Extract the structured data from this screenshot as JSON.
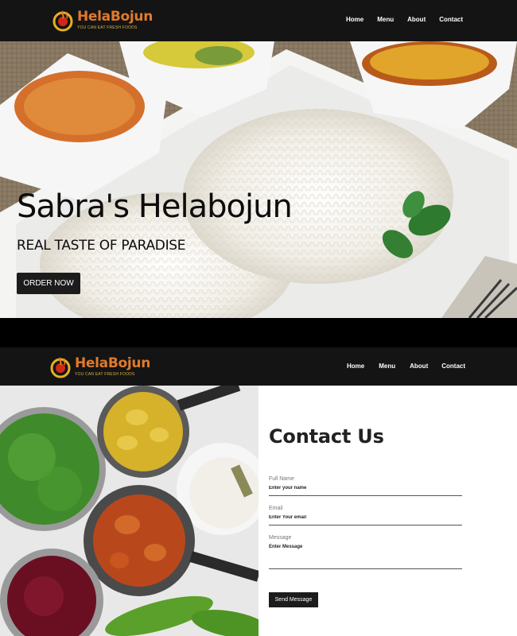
{
  "brand": {
    "name": "HelaBojun",
    "tagline": "YOU CAN EAT FRESH FOODS",
    "color": "#e07a2b"
  },
  "nav": {
    "items": [
      {
        "label": "Home"
      },
      {
        "label": "Menu"
      },
      {
        "label": "About"
      },
      {
        "label": "Contact"
      }
    ]
  },
  "hero": {
    "title": "Sabra's Helabojun",
    "subtitle": "REAL TASTE OF PARADISE",
    "cta_label": "ORDER NOW"
  },
  "contact": {
    "title": "Contact Us",
    "fields": {
      "name": {
        "label": "Full Name",
        "placeholder": "Enter your name"
      },
      "email": {
        "label": "Email",
        "placeholder": "Enter Your email"
      },
      "message": {
        "label": "Message",
        "placeholder": "Enter Message"
      }
    },
    "submit_label": "Send Message"
  },
  "colors": {
    "navbar": "#141414",
    "button": "#1c1c1c",
    "accent": "#e07a2b"
  }
}
